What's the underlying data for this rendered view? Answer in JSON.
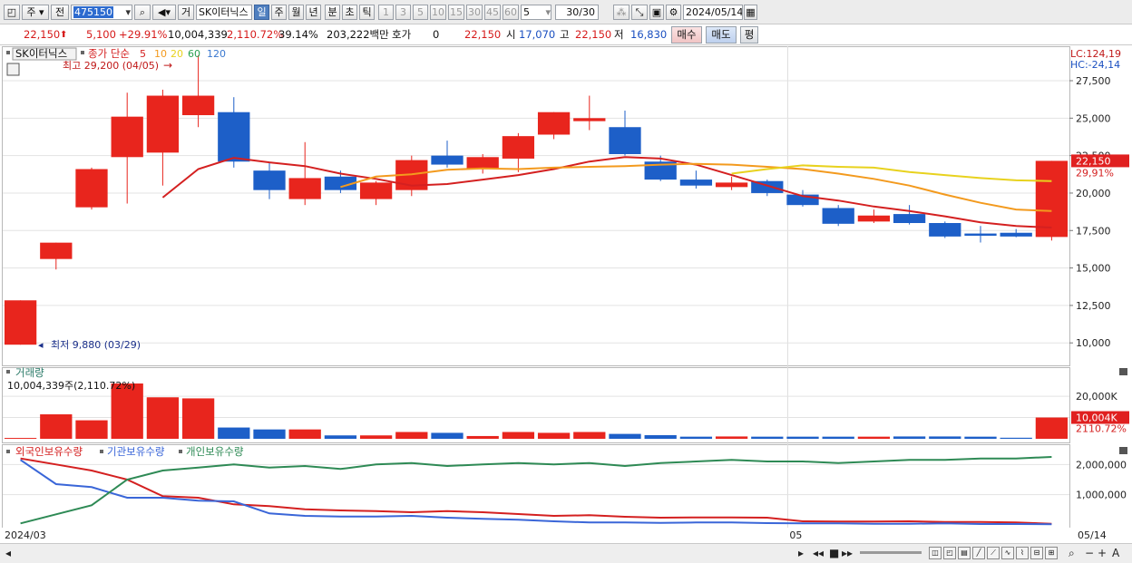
{
  "toolbar": {
    "period_main": "주",
    "period_all": "전",
    "code": "475150",
    "trade_label": "거",
    "stock_name": "SK이터닉스",
    "periods": [
      "일",
      "주",
      "월",
      "년",
      "분",
      "초",
      "틱"
    ],
    "active_period": "일",
    "minute_options": [
      "1",
      "3",
      "5",
      "10",
      "15",
      "30",
      "45",
      "60"
    ],
    "selected_minute": "5",
    "count": "30/30",
    "date": "2024/05/14"
  },
  "quote": {
    "price": "22,150",
    "change": "5,100",
    "change_pct": "+29.91%",
    "volume": "10,004,339",
    "volume_ratio": "2,110.72%",
    "turnover": "39.14%",
    "amount": "203,222백만",
    "hoga_label": "호가",
    "hoga_value": "0",
    "current": "22,150",
    "open_label": "시",
    "open": "17,070",
    "high_label": "고",
    "high": "22,150",
    "low_label": "저",
    "low": "16,830",
    "buy_label": "매수",
    "sell_label": "매도",
    "eval_label": "평"
  },
  "price_panel": {
    "stock_label": "SK이터닉스",
    "ma_title": "종가 단순",
    "ma_periods": [
      {
        "period": "5",
        "color": "#e02020"
      },
      {
        "period": "10",
        "color": "#f39a1e"
      },
      {
        "period": "20",
        "color": "#e8d21e"
      },
      {
        "period": "60",
        "color": "#2aa050"
      },
      {
        "period": "120",
        "color": "#3a78d0"
      }
    ],
    "high_note": "최고 29,200 (04/05)",
    "low_note": "최저 9,880 (03/29)",
    "lc": "LC:124,19",
    "hc": "HC:-24,14",
    "current_tag": "22,150",
    "current_pct": "29,91%",
    "y_ticks": [
      "27,500",
      "25,000",
      "22,500",
      "20,000",
      "17,500",
      "15,000",
      "12,500",
      "10,000"
    ]
  },
  "volume_panel": {
    "title": "거래량",
    "value_note": "10,004,339주(2,110.72%)",
    "y_ticks": [
      "20,000K",
      "10,000K"
    ],
    "current_tag": "10,004K",
    "current_pct": "2110.72%"
  },
  "holding_panel": {
    "legends": [
      {
        "label": "외국인보유수량",
        "color": "#d42020"
      },
      {
        "label": "기관보유수량",
        "color": "#3a66d8"
      },
      {
        "label": "개인보유수량",
        "color": "#2e8a55"
      }
    ],
    "y_ticks": [
      "2,000,000",
      "1,000,000"
    ]
  },
  "x_axis": {
    "left": "2024/03",
    "mid": "05",
    "right": "05/14"
  },
  "colors": {
    "up": "#e8251d",
    "down": "#1d5fc8",
    "grid": "#e3e3e3",
    "panel_border": "#b8b8b8"
  },
  "chart_data": [
    {
      "type": "candlestick",
      "title": "SK이터닉스",
      "ylim": [
        8500,
        29800
      ],
      "candles": [
        {
          "o": 9880,
          "h": 12840,
          "l": 9880,
          "c": 12840
        },
        {
          "o": 15600,
          "h": 16690,
          "l": 14900,
          "c": 16690
        },
        {
          "o": 19050,
          "h": 21700,
          "l": 18900,
          "c": 21600
        },
        {
          "o": 22400,
          "h": 26700,
          "l": 19300,
          "c": 25100
        },
        {
          "o": 22700,
          "h": 26900,
          "l": 20500,
          "c": 26500
        },
        {
          "o": 25200,
          "h": 29200,
          "l": 24400,
          "c": 26500
        },
        {
          "o": 25400,
          "h": 26400,
          "l": 21700,
          "c": 22100
        },
        {
          "o": 21500,
          "h": 22000,
          "l": 19600,
          "c": 20200
        },
        {
          "o": 19600,
          "h": 23400,
          "l": 19200,
          "c": 21000
        },
        {
          "o": 21100,
          "h": 21500,
          "l": 20000,
          "c": 20200
        },
        {
          "o": 19600,
          "h": 20800,
          "l": 19200,
          "c": 20700
        },
        {
          "o": 20200,
          "h": 22500,
          "l": 19800,
          "c": 22200
        },
        {
          "o": 22500,
          "h": 23500,
          "l": 21700,
          "c": 21900
        },
        {
          "o": 21600,
          "h": 22600,
          "l": 21300,
          "c": 22400
        },
        {
          "o": 22300,
          "h": 24000,
          "l": 21400,
          "c": 23800
        },
        {
          "o": 23900,
          "h": 25400,
          "l": 23600,
          "c": 25400
        },
        {
          "o": 24800,
          "h": 26500,
          "l": 24200,
          "c": 25000
        },
        {
          "o": 24400,
          "h": 25500,
          "l": 22500,
          "c": 22600
        },
        {
          "o": 22100,
          "h": 22500,
          "l": 20800,
          "c": 20900
        },
        {
          "o": 20900,
          "h": 21500,
          "l": 20300,
          "c": 20500
        },
        {
          "o": 20400,
          "h": 21100,
          "l": 20200,
          "c": 20700
        },
        {
          "o": 20800,
          "h": 20900,
          "l": 19800,
          "c": 20000
        },
        {
          "o": 19900,
          "h": 20200,
          "l": 19100,
          "c": 19200
        },
        {
          "o": 19000,
          "h": 19200,
          "l": 17800,
          "c": 17950
        },
        {
          "o": 18100,
          "h": 18900,
          "l": 18000,
          "c": 18500
        },
        {
          "o": 18600,
          "h": 19200,
          "l": 17900,
          "c": 18000
        },
        {
          "o": 18000,
          "h": 18100,
          "l": 17000,
          "c": 17100
        },
        {
          "o": 17300,
          "h": 17800,
          "l": 16700,
          "c": 17150
        },
        {
          "o": 17350,
          "h": 17600,
          "l": 17050,
          "c": 17100
        },
        {
          "o": 17070,
          "h": 22150,
          "l": 16830,
          "c": 22150
        }
      ],
      "ma": [
        {
          "period": "5",
          "color": "#d42020",
          "values": [
            null,
            null,
            null,
            null,
            19700,
            21600,
            22350,
            22050,
            21800,
            21300,
            20950,
            20500,
            20600,
            20900,
            21200,
            21600,
            22100,
            22400,
            22300,
            21900,
            21200,
            20500,
            19800,
            19500,
            19100,
            18800,
            18450,
            18050,
            17800,
            17700
          ]
        },
        {
          "period": "10",
          "color": "#f39a1e",
          "values": [
            null,
            null,
            null,
            null,
            null,
            null,
            null,
            null,
            null,
            20400,
            21100,
            21250,
            21550,
            21650,
            21600,
            21700,
            21750,
            21800,
            21900,
            21950,
            21900,
            21750,
            21600,
            21300,
            20950,
            20500,
            19900,
            19350,
            18900,
            18800
          ]
        },
        {
          "period": "20",
          "color": "#e8d21e",
          "values": [
            null,
            null,
            null,
            null,
            null,
            null,
            null,
            null,
            null,
            null,
            null,
            null,
            null,
            null,
            null,
            null,
            null,
            null,
            null,
            null,
            21300,
            21600,
            21850,
            21750,
            21700,
            21400,
            21200,
            21000,
            20850,
            20800
          ]
        }
      ],
      "high_label": {
        "value": 29200,
        "date": "04/05"
      },
      "low_label": {
        "value": 9880,
        "date": "03/29"
      }
    },
    {
      "type": "bar",
      "title": "거래량",
      "ylim": [
        0,
        26000000
      ],
      "values": [
        400000,
        11500000,
        8700000,
        26000000,
        19500000,
        19000000,
        5300000,
        4400000,
        4400000,
        1600000,
        1600000,
        3200000,
        2800000,
        1300000,
        3200000,
        2800000,
        3200000,
        2300000,
        1700000,
        1000000,
        1100000,
        1000000,
        1000000,
        1000000,
        1000000,
        1100000,
        1100000,
        1000000,
        500000,
        10004339
      ]
    },
    {
      "type": "line",
      "title": "보유수량",
      "ylim": [
        0,
        2400000
      ],
      "series": [
        {
          "name": "외국인보유수량",
          "values": [
            2200000,
            2000000,
            1800000,
            1500000,
            950000,
            900000,
            680000,
            620000,
            520000,
            480000,
            460000,
            420000,
            460000,
            420000,
            360000,
            300000,
            320000,
            270000,
            240000,
            250000,
            250000,
            240000,
            120000,
            110000,
            110000,
            120000,
            100000,
            100000,
            80000,
            40000
          ]
        },
        {
          "name": "기관보유수량",
          "values": [
            2150000,
            1350000,
            1250000,
            900000,
            900000,
            800000,
            780000,
            380000,
            300000,
            280000,
            280000,
            300000,
            240000,
            200000,
            170000,
            120000,
            80000,
            80000,
            70000,
            80000,
            80000,
            60000,
            50000,
            50000,
            40000,
            40000,
            50000,
            30000,
            30000,
            20000
          ]
        },
        {
          "name": "개인보유수량",
          "values": [
            50000,
            350000,
            650000,
            1500000,
            1800000,
            1900000,
            2000000,
            1900000,
            1950000,
            1850000,
            2000000,
            2050000,
            1950000,
            2000000,
            2050000,
            2000000,
            2050000,
            1950000,
            2050000,
            2100000,
            2150000,
            2100000,
            2100000,
            2050000,
            2100000,
            2150000,
            2150000,
            2200000,
            2200000,
            2250000
          ]
        }
      ]
    }
  ]
}
